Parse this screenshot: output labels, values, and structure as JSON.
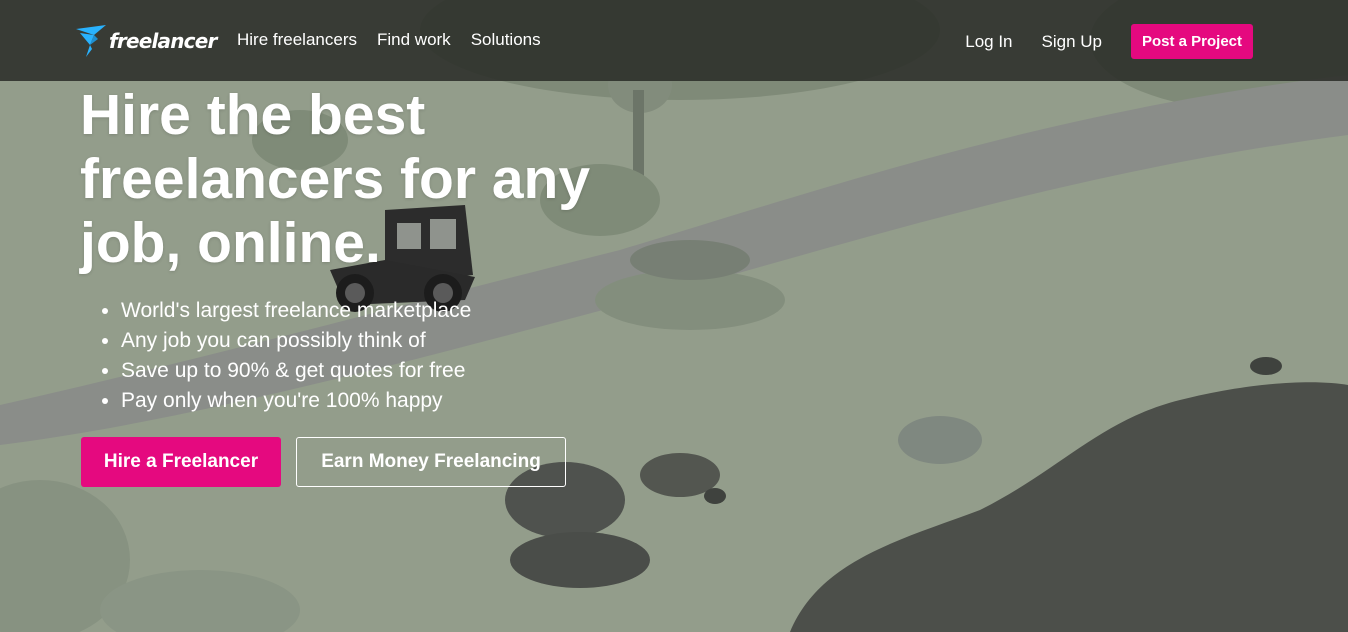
{
  "brand": {
    "name": "freelancer",
    "logo_icon": "bird-logo-icon",
    "accent_color": "#e5097f",
    "logo_color": "#29b2fe"
  },
  "nav": {
    "links": [
      "Hire freelancers",
      "Find work",
      "Solutions"
    ],
    "login": "Log In",
    "signup": "Sign Up",
    "post_project": "Post a Project"
  },
  "hero": {
    "title": "Hire the best freelancers for any job, online.",
    "bullets": [
      "World's largest freelance marketplace",
      "Any job you can possibly think of",
      "Save up to 90% & get quotes for free",
      "Pay only when you're 100% happy"
    ],
    "primary_cta": "Hire a Freelancer",
    "secondary_cta": "Earn Money Freelancing"
  },
  "background": {
    "icon": "vintage-car-icon"
  }
}
